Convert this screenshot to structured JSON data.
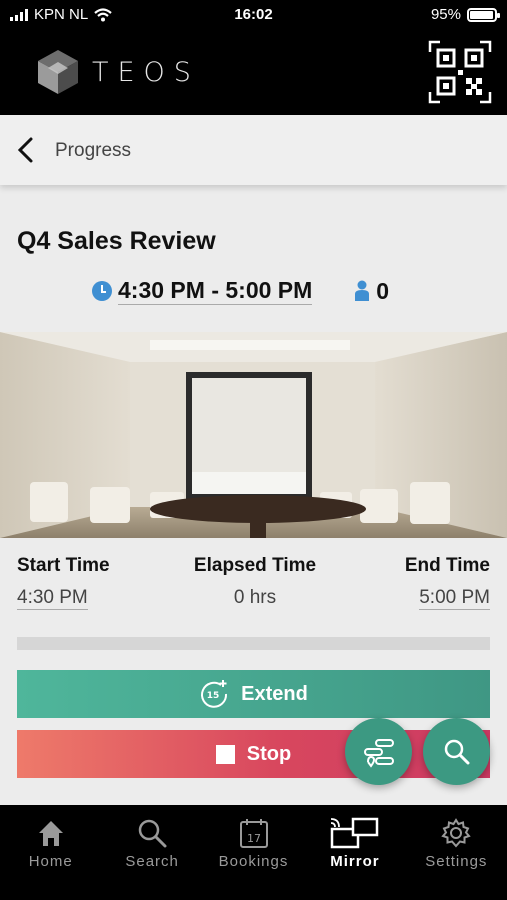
{
  "status": {
    "carrier": "KPN NL",
    "time": "16:02",
    "battery": "95%",
    "battery_level": 0.95
  },
  "header": {
    "logo_text": "TEOS",
    "qr_icon": "qr-code-icon"
  },
  "nav": {
    "back_icon": "chevron-left-icon",
    "title": "Progress"
  },
  "meeting": {
    "title": "Q4 Sales Review",
    "time_range": "4:30 PM - 5:00 PM",
    "attendees": "0"
  },
  "times": {
    "start_label": "Start Time",
    "start_value": "4:30 PM",
    "elapsed_label": "Elapsed Time",
    "elapsed_value": "0 hrs",
    "end_label": "End Time",
    "end_value": "5:00 PM"
  },
  "progress": {
    "fraction": 0.0
  },
  "actions": {
    "extend_label": "Extend",
    "extend_badge": "15",
    "stop_label": "Stop"
  },
  "fabs": {
    "route_icon": "route-map-icon",
    "search_icon": "search-icon"
  },
  "tabs": [
    {
      "label": "Home",
      "icon": "home-icon",
      "active": false
    },
    {
      "label": "Search",
      "icon": "search-icon",
      "active": false
    },
    {
      "label": "Bookings",
      "icon": "calendar-icon",
      "badge": "17",
      "active": false
    },
    {
      "label": "Mirror",
      "icon": "mirror-screens-icon",
      "active": true
    },
    {
      "label": "Settings",
      "icon": "gear-icon",
      "active": false
    }
  ],
  "colors": {
    "accent": "#4aa391",
    "stop": "#d8475e",
    "clock": "#3f8fd2",
    "person": "#3f8fd2"
  }
}
